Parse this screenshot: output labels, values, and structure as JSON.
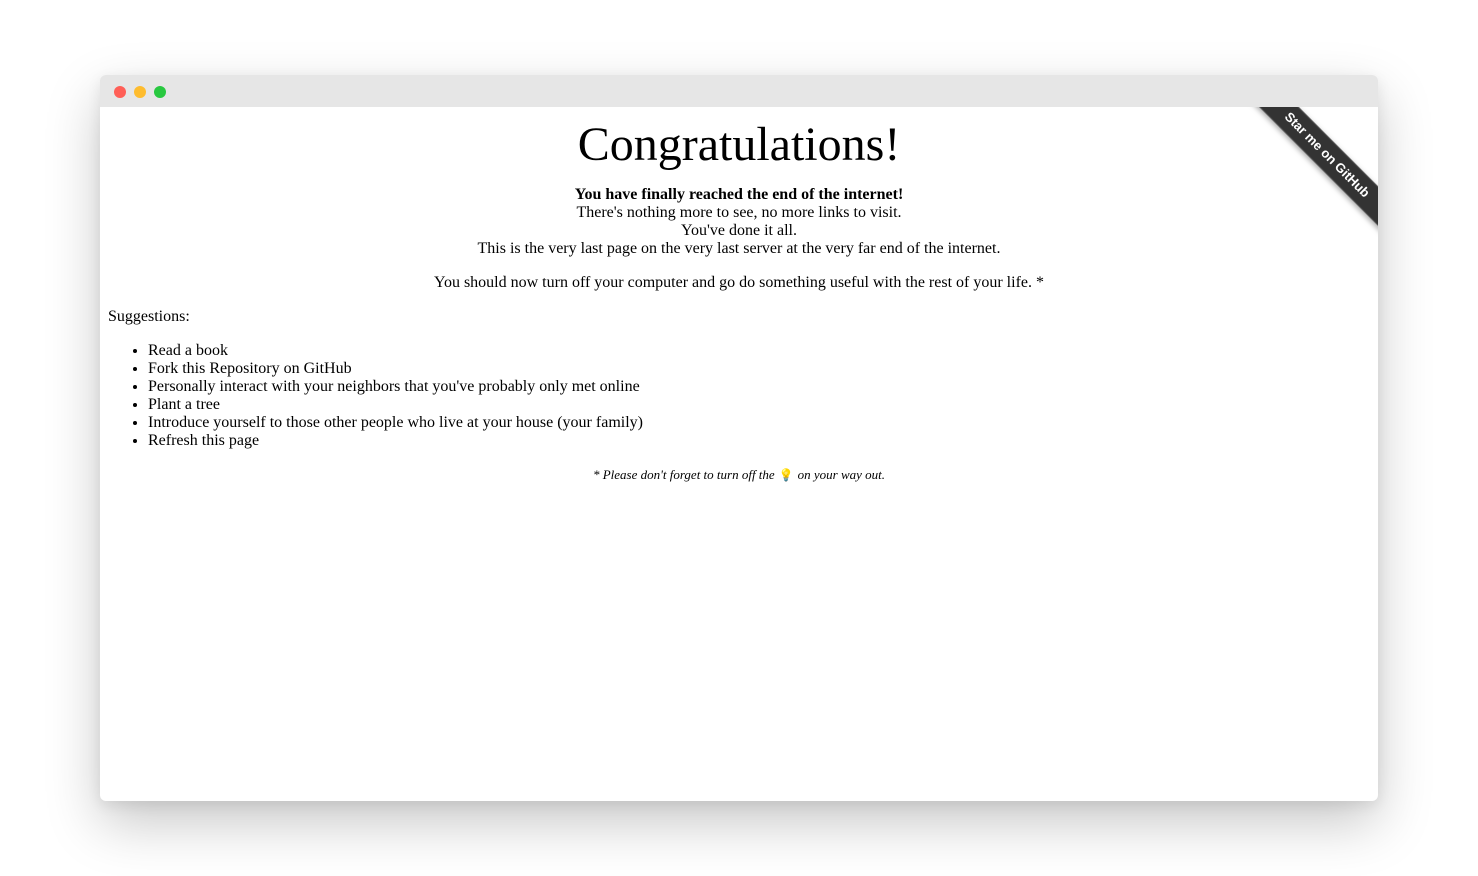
{
  "window": {
    "controls": [
      "close",
      "minimize",
      "maximize"
    ]
  },
  "ribbon": {
    "label": "Star me on GitHub"
  },
  "main": {
    "title": "Congratulations!",
    "intro_bold": "You have finally reached the end of the internet!",
    "intro_lines": [
      "There's nothing more to see, no more links to visit.",
      "You've done it all.",
      "This is the very last page on the very last server at the very far end of the internet."
    ],
    "advice": "You should now turn off your computer and go do something useful with the rest of your life. *",
    "suggestions_label": "Suggestions:",
    "suggestions": [
      "Read a book",
      "Fork this Repository on GitHub",
      "Personally interact with your neighbors that you've probably only met online",
      "Plant a tree",
      "Introduce yourself to those other people who live at your house (your family)",
      "Refresh this page"
    ],
    "footnote_before": "* Please don't forget to turn off the",
    "footnote_icon": "lightbulb-icon",
    "footnote_after": "on your way out."
  }
}
